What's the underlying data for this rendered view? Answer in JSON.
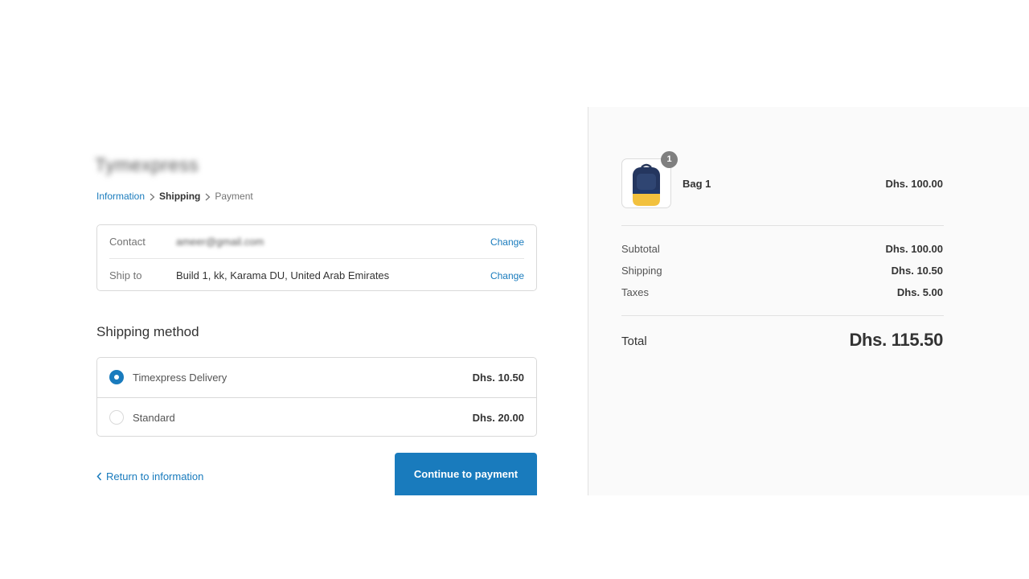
{
  "store": {
    "name": "Tymexpress"
  },
  "breadcrumb": {
    "information": "Information",
    "shipping": "Shipping",
    "payment": "Payment"
  },
  "review": {
    "contact_label": "Contact",
    "contact_value": "ameer@gmail.com",
    "contact_change": "Change",
    "shipto_label": "Ship to",
    "shipto_value": "Build 1, kk, Karama DU, United Arab Emirates",
    "shipto_change": "Change"
  },
  "shipping_method": {
    "title": "Shipping method",
    "options": [
      {
        "label": "Timexpress Delivery",
        "price": "Dhs. 10.50",
        "selected": true
      },
      {
        "label": "Standard",
        "price": "Dhs. 20.00",
        "selected": false
      }
    ]
  },
  "actions": {
    "return_label": "Return to information",
    "continue_label": "Continue to payment"
  },
  "order_summary": {
    "item": {
      "name": "Bag 1",
      "price": "Dhs. 100.00",
      "quantity": "1"
    },
    "subtotal_label": "Subtotal",
    "subtotal_value": "Dhs. 100.00",
    "shipping_label": "Shipping",
    "shipping_value": "Dhs. 10.50",
    "taxes_label": "Taxes",
    "taxes_value": "Dhs. 5.00",
    "total_label": "Total",
    "total_value": "Dhs. 115.50"
  },
  "colors": {
    "accent": "#197bbd",
    "sidebar_bg": "#fafafa",
    "border": "#d9d9d9",
    "badge": "#7f7f7f"
  }
}
